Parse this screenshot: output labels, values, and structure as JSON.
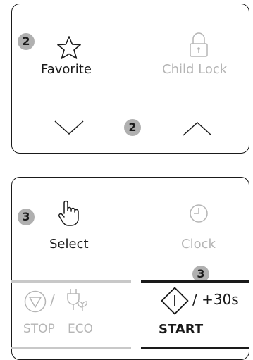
{
  "top_panel": {
    "favorite_badge": "2",
    "favorite_label": "Favorite",
    "child_lock_label": "Child Lock",
    "arrows_badge": "2",
    "icons": [
      "star-icon",
      "lock-icon",
      "chevron-down-icon",
      "chevron-up-icon"
    ]
  },
  "bottom_panel": {
    "select_badge": "3",
    "select_label": "Select",
    "clock_label": "Clock",
    "start_badge": "3",
    "stop_label": "STOP",
    "eco_label": "ECO",
    "plus30_label": "/ +30s",
    "start_label": "START",
    "separator_slash": "/",
    "icons": [
      "hand-pointer-icon",
      "clock-icon",
      "stop-icon",
      "eco-plug-icon",
      "start-icon"
    ]
  },
  "colors": {
    "text": "#1a1a1a",
    "disabled": "#b5b5b5",
    "badge": "#b0b0b0",
    "rule_grey": "#c8c8c8"
  }
}
